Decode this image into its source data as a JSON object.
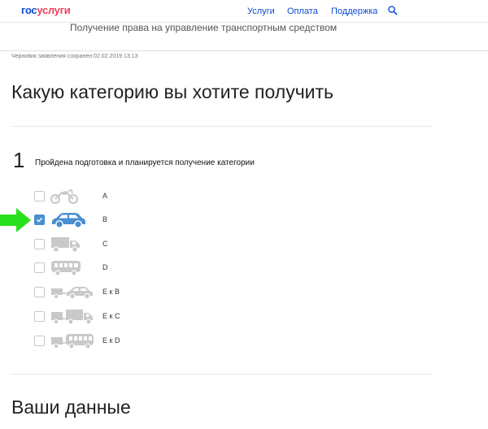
{
  "header": {
    "logo_part1": "гос",
    "logo_part2": "услуги",
    "nav": [
      "Услуги",
      "Оплата",
      "Поддержка"
    ]
  },
  "service_title": "Получение права на управление транспортным средством",
  "draft_status": "Черновик заявления сохранен 02.02.2019 13:13",
  "page_heading": "Какую категорию вы хотите получить",
  "step": {
    "number": "1",
    "text": "Пройдена подготовка и планируется получение категории"
  },
  "categories": [
    {
      "label": "A",
      "icon": "motorcycle-icon",
      "checked": false
    },
    {
      "label": "B",
      "icon": "car-icon",
      "checked": true
    },
    {
      "label": "C",
      "icon": "truck-icon",
      "checked": false
    },
    {
      "label": "D",
      "icon": "bus-icon",
      "checked": false
    },
    {
      "label": "E к B",
      "icon": "car-trailer-icon",
      "checked": false
    },
    {
      "label": "E к C",
      "icon": "truck-trailer-icon",
      "checked": false
    },
    {
      "label": "E к D",
      "icon": "bus-trailer-icon",
      "checked": false
    }
  ],
  "section2_heading": "Ваши данные",
  "colors": {
    "brand_blue": "#0d4cd3",
    "brand_red": "#ee3f58",
    "checkbox_checked": "#4a8fd0",
    "icon_gray": "#c9c9c9",
    "icon_active": "#4a8fd0",
    "arrow_green": "#29e01e"
  }
}
